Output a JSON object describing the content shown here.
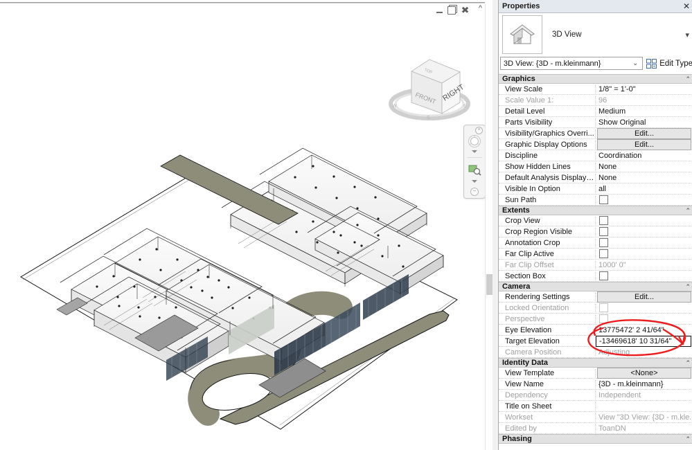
{
  "window": {
    "mdi_minimize": "minimize",
    "mdi_restore": "restore",
    "mdi_close": "close",
    "mdi_chevron": "^"
  },
  "viewcube": {
    "front_face": "FRONT",
    "right_face": "RIGHT",
    "top_face": "TOP",
    "compass_n": "N",
    "compass_e": "E",
    "compass_s": "S",
    "compass_w": "W"
  },
  "navbar": {
    "close_glyph": "×",
    "steering_wheel": "steering-wheel-icon",
    "zoom_tool": "zoom-region-icon",
    "caret_glyph": "▼",
    "bottom_glyph": "−"
  },
  "panel": {
    "title": "Properties",
    "close_glyph": "✕",
    "family_label": "3D View",
    "more_glyph": "▾",
    "type_selector_value": "3D View: {3D - m.kleinmann}",
    "type_selector_chevron": "⌄",
    "edit_type_label": "Edit Type",
    "edit_type_icon": "edit-type-icon"
  },
  "sections": [
    {
      "name": "Graphics",
      "collapse_glyph": "⌃",
      "rows": [
        {
          "name": "View Scale",
          "value": "1/8\" = 1'-0\"",
          "kind": "text",
          "dim": false
        },
        {
          "name": "Scale Value    1:",
          "value": "96",
          "kind": "text",
          "dim": true
        },
        {
          "name": "Detail Level",
          "value": "Medium",
          "kind": "text",
          "dim": false
        },
        {
          "name": "Parts Visibility",
          "value": "Show Original",
          "kind": "text",
          "dim": false
        },
        {
          "name": "Visibility/Graphics Overri...",
          "value": "Edit...",
          "kind": "button",
          "dim": false
        },
        {
          "name": "Graphic Display Options",
          "value": "Edit...",
          "kind": "button",
          "dim": false
        },
        {
          "name": "Discipline",
          "value": "Coordination",
          "kind": "text",
          "dim": false
        },
        {
          "name": "Show Hidden Lines",
          "value": "None",
          "kind": "text",
          "dim": false
        },
        {
          "name": "Default Analysis Display S...",
          "value": "None",
          "kind": "text",
          "dim": false
        },
        {
          "name": "Visible In Option",
          "value": "all",
          "kind": "text",
          "dim": false
        },
        {
          "name": "Sun Path",
          "value": "",
          "kind": "check",
          "dim": false,
          "checked": false
        }
      ]
    },
    {
      "name": "Extents",
      "collapse_glyph": "⌃",
      "rows": [
        {
          "name": "Crop View",
          "value": "",
          "kind": "check",
          "dim": false,
          "checked": false
        },
        {
          "name": "Crop Region Visible",
          "value": "",
          "kind": "check",
          "dim": false,
          "checked": false
        },
        {
          "name": "Annotation Crop",
          "value": "",
          "kind": "check",
          "dim": false,
          "checked": false
        },
        {
          "name": "Far Clip Active",
          "value": "",
          "kind": "check",
          "dim": false,
          "checked": false
        },
        {
          "name": "Far Clip Offset",
          "value": "1000'  0\"",
          "kind": "text",
          "dim": true
        },
        {
          "name": "Section Box",
          "value": "",
          "kind": "check",
          "dim": false,
          "checked": false
        }
      ]
    },
    {
      "name": "Camera",
      "collapse_glyph": "⌃",
      "rows": [
        {
          "name": "Rendering Settings",
          "value": "Edit...",
          "kind": "button",
          "dim": false
        },
        {
          "name": "Locked Orientation",
          "value": "",
          "kind": "check",
          "dim": true,
          "checked": false
        },
        {
          "name": "Perspective",
          "value": "",
          "kind": "check",
          "dim": true,
          "checked": false
        },
        {
          "name": "Eye Elevation",
          "value": "13775472'  2 41/64\"",
          "kind": "text",
          "dim": false
        },
        {
          "name": "Target Elevation",
          "value": "-13469618'  10 31/64\"",
          "kind": "boxed",
          "dim": false
        },
        {
          "name": "Camera Position",
          "value": "Adjusting",
          "kind": "text",
          "dim": true
        }
      ]
    },
    {
      "name": "Identity Data",
      "collapse_glyph": "⌃",
      "rows": [
        {
          "name": "View Template",
          "value": "<None>",
          "kind": "button",
          "dim": false
        },
        {
          "name": "View Name",
          "value": "{3D - m.kleinmann}",
          "kind": "text",
          "dim": false
        },
        {
          "name": "Dependency",
          "value": "Independent",
          "kind": "text",
          "dim": true
        },
        {
          "name": "Title on Sheet",
          "value": "",
          "kind": "text",
          "dim": false
        },
        {
          "name": "Workset",
          "value": "View \"3D View: {3D - m.kle...",
          "kind": "text",
          "dim": true
        },
        {
          "name": "Edited by",
          "value": "ToanDN",
          "kind": "text",
          "dim": true
        }
      ]
    },
    {
      "name": "Phasing",
      "collapse_glyph": "⌃",
      "rows": []
    }
  ],
  "annotation": {
    "shape": "red-ellipse-highlight",
    "color": "#ee1c1c"
  },
  "colors": {
    "section_header_bg": "#e1e1e1",
    "panel_title_bg": "#e4e8ef",
    "road_fill": "#8d8d79",
    "annotation_red": "#ee1c1c"
  }
}
